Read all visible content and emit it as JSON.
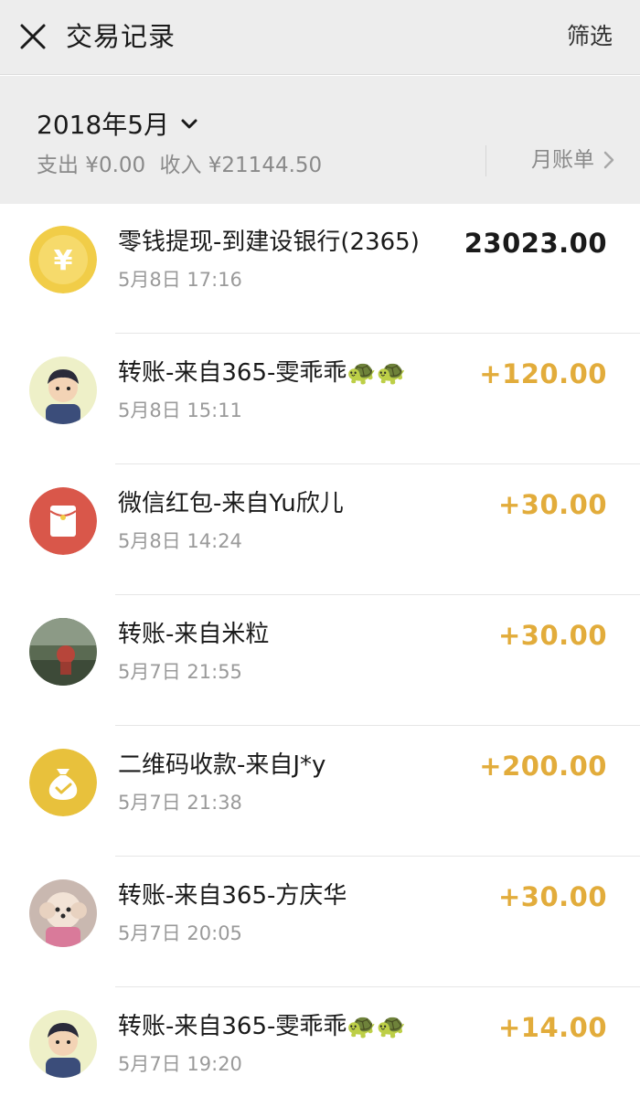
{
  "header": {
    "title": "交易记录",
    "filter_label": "筛选",
    "close_icon": "close-icon"
  },
  "summary": {
    "month": "2018年5月",
    "expense": "支出 ¥0.00",
    "income": "收入 ¥21144.50",
    "monthly_bill_label": "月账单"
  },
  "colors": {
    "income_amount": "#e2ac3b",
    "neutral_amount": "#1a1a1a",
    "coin_icon_bg": "#f1cd48",
    "red_packet_bg": "#d9574a",
    "qr_payment_bg": "#e8c13c",
    "header_bg": "#ededed"
  },
  "transactions": [
    {
      "title": "零钱提现-到建设银行(2365)",
      "time": "5月8日 17:16",
      "amount": "23023.00",
      "icon": "yuan-coin-icon",
      "kind": "neutral"
    },
    {
      "title": "转账-来自365-雯乖乖🐢🐢",
      "time": "5月8日 15:11",
      "amount": "+120.00",
      "icon": "child-avatar",
      "kind": "income"
    },
    {
      "title": "微信红包-来自Yu欣儿",
      "time": "5月8日 14:24",
      "amount": "+30.00",
      "icon": "red-packet-icon",
      "kind": "income"
    },
    {
      "title": "转账-来自米粒",
      "time": "5月7日 21:55",
      "amount": "+30.00",
      "icon": "outdoor-photo-avatar",
      "kind": "income"
    },
    {
      "title": "二维码收款-来自J*y",
      "time": "5月7日 21:38",
      "amount": "+200.00",
      "icon": "money-bag-icon",
      "kind": "income"
    },
    {
      "title": "转账-来自365-方庆华",
      "time": "5月7日 20:05",
      "amount": "+30.00",
      "icon": "dog-avatar",
      "kind": "income"
    },
    {
      "title": "转账-来自365-雯乖乖🐢🐢",
      "time": "5月7日 19:20",
      "amount": "+14.00",
      "icon": "child-avatar",
      "kind": "income"
    }
  ]
}
